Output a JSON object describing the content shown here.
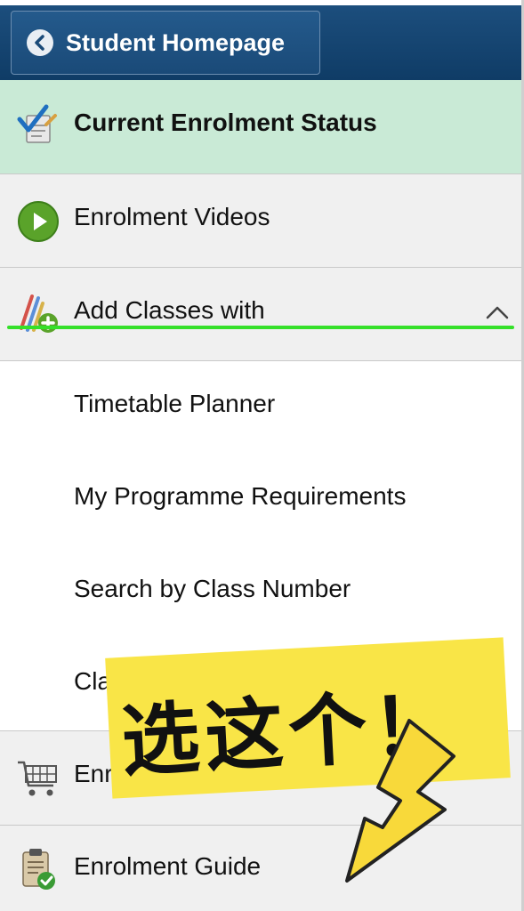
{
  "header": {
    "back_label": "Student Homepage"
  },
  "nav": {
    "current_status": "Current Enrolment Status",
    "videos": "Enrolment Videos",
    "add_classes": "Add Classes with",
    "add_classes_items": [
      "Timetable Planner",
      "My Programme Requirements",
      "Search by Class Number",
      "Class Search"
    ],
    "cart": "Enrolment Cart",
    "guide": "Enrolment Guide"
  },
  "annotation": {
    "text": "选这个！"
  },
  "icons": {
    "back": "chevron-left-icon",
    "status": "checklist-check-icon",
    "videos": "play-circle-icon",
    "add_classes": "pencils-add-icon",
    "expand": "chevron-up-icon",
    "cart": "shopping-cart-icon",
    "guide": "clipboard-check-icon",
    "pointer": "arrow-down-left-icon"
  },
  "colors": {
    "header": "#16436f",
    "active_item": "#c9ead6",
    "item_bg": "#f0f0f0",
    "highlight_line": "#35e02a",
    "sticker": "#f9e547",
    "arrow": "#f8d93a"
  }
}
